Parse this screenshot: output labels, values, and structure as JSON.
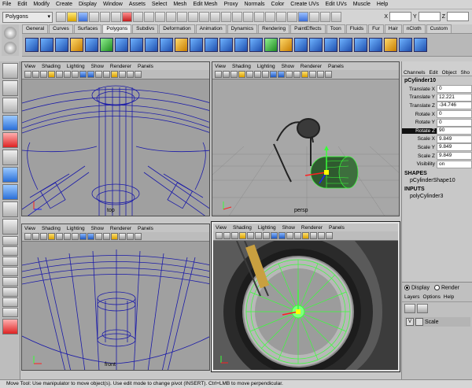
{
  "menubar": [
    "File",
    "Edit",
    "Modify",
    "Create",
    "Display",
    "Window",
    "Assets",
    "Select",
    "Mesh",
    "Edit Mesh",
    "Proxy",
    "Normals",
    "Color",
    "Create UVs",
    "Edit UVs",
    "Muscle",
    "Help"
  ],
  "statusline": {
    "mode": "Polygons",
    "x_label": "X",
    "y_label": "Y",
    "z_label": "Z"
  },
  "shelf_tabs": [
    "General",
    "Curves",
    "Surfaces",
    "Polygons",
    "Subdivs",
    "Deformation",
    "Animation",
    "Dynamics",
    "Rendering",
    "PaintEffects",
    "Toon",
    "Fluids",
    "Fur",
    "Hair",
    "nCloth",
    "Custom"
  ],
  "active_shelf_tab": "Polygons",
  "panel_menu": [
    "View",
    "Shading",
    "Lighting",
    "Show",
    "Renderer",
    "Panels"
  ],
  "viewports": {
    "top_left": {
      "camera": "top"
    },
    "top_right": {
      "camera": "persp"
    },
    "bottom_left": {
      "camera": "front"
    },
    "bottom_right": {
      "camera": ""
    }
  },
  "channel_box": {
    "tabs": [
      "Channels",
      "Edit",
      "Object",
      "Sho"
    ],
    "object": "pCylinder10",
    "attributes": [
      {
        "label": "Translate X",
        "value": "0"
      },
      {
        "label": "Translate Y",
        "value": "12.221"
      },
      {
        "label": "Translate Z",
        "value": "-34.746"
      },
      {
        "label": "Rotate X",
        "value": "0"
      },
      {
        "label": "Rotate Y",
        "value": "0"
      },
      {
        "label": "Rotate Z",
        "value": "90"
      },
      {
        "label": "Scale X",
        "value": "9.849"
      },
      {
        "label": "Scale Y",
        "value": "9.849"
      },
      {
        "label": "Scale Z",
        "value": "9.849"
      },
      {
        "label": "Visibility",
        "value": "on"
      }
    ],
    "highlighted_attribute": "Rotate Z",
    "shapes_header": "SHAPES",
    "shape": "pCylinderShape10",
    "inputs_header": "INPUTS",
    "input": "polyCylinder3"
  },
  "layers": {
    "display_label": "Display",
    "render_label": "Render",
    "menu": [
      "Layers",
      "Options",
      "Help"
    ],
    "layer_name": "Scale",
    "layer_visible": "V"
  },
  "helpline": "Move Tool: Use manipulator to move object(s). Use edit mode to change pivot (INSERT). Ctrl+LMB to move perpendicular.",
  "colors": {
    "wire_blue": "#1a1aa8",
    "selected_green": "#39ff39",
    "manip_red": "#ff2020"
  }
}
